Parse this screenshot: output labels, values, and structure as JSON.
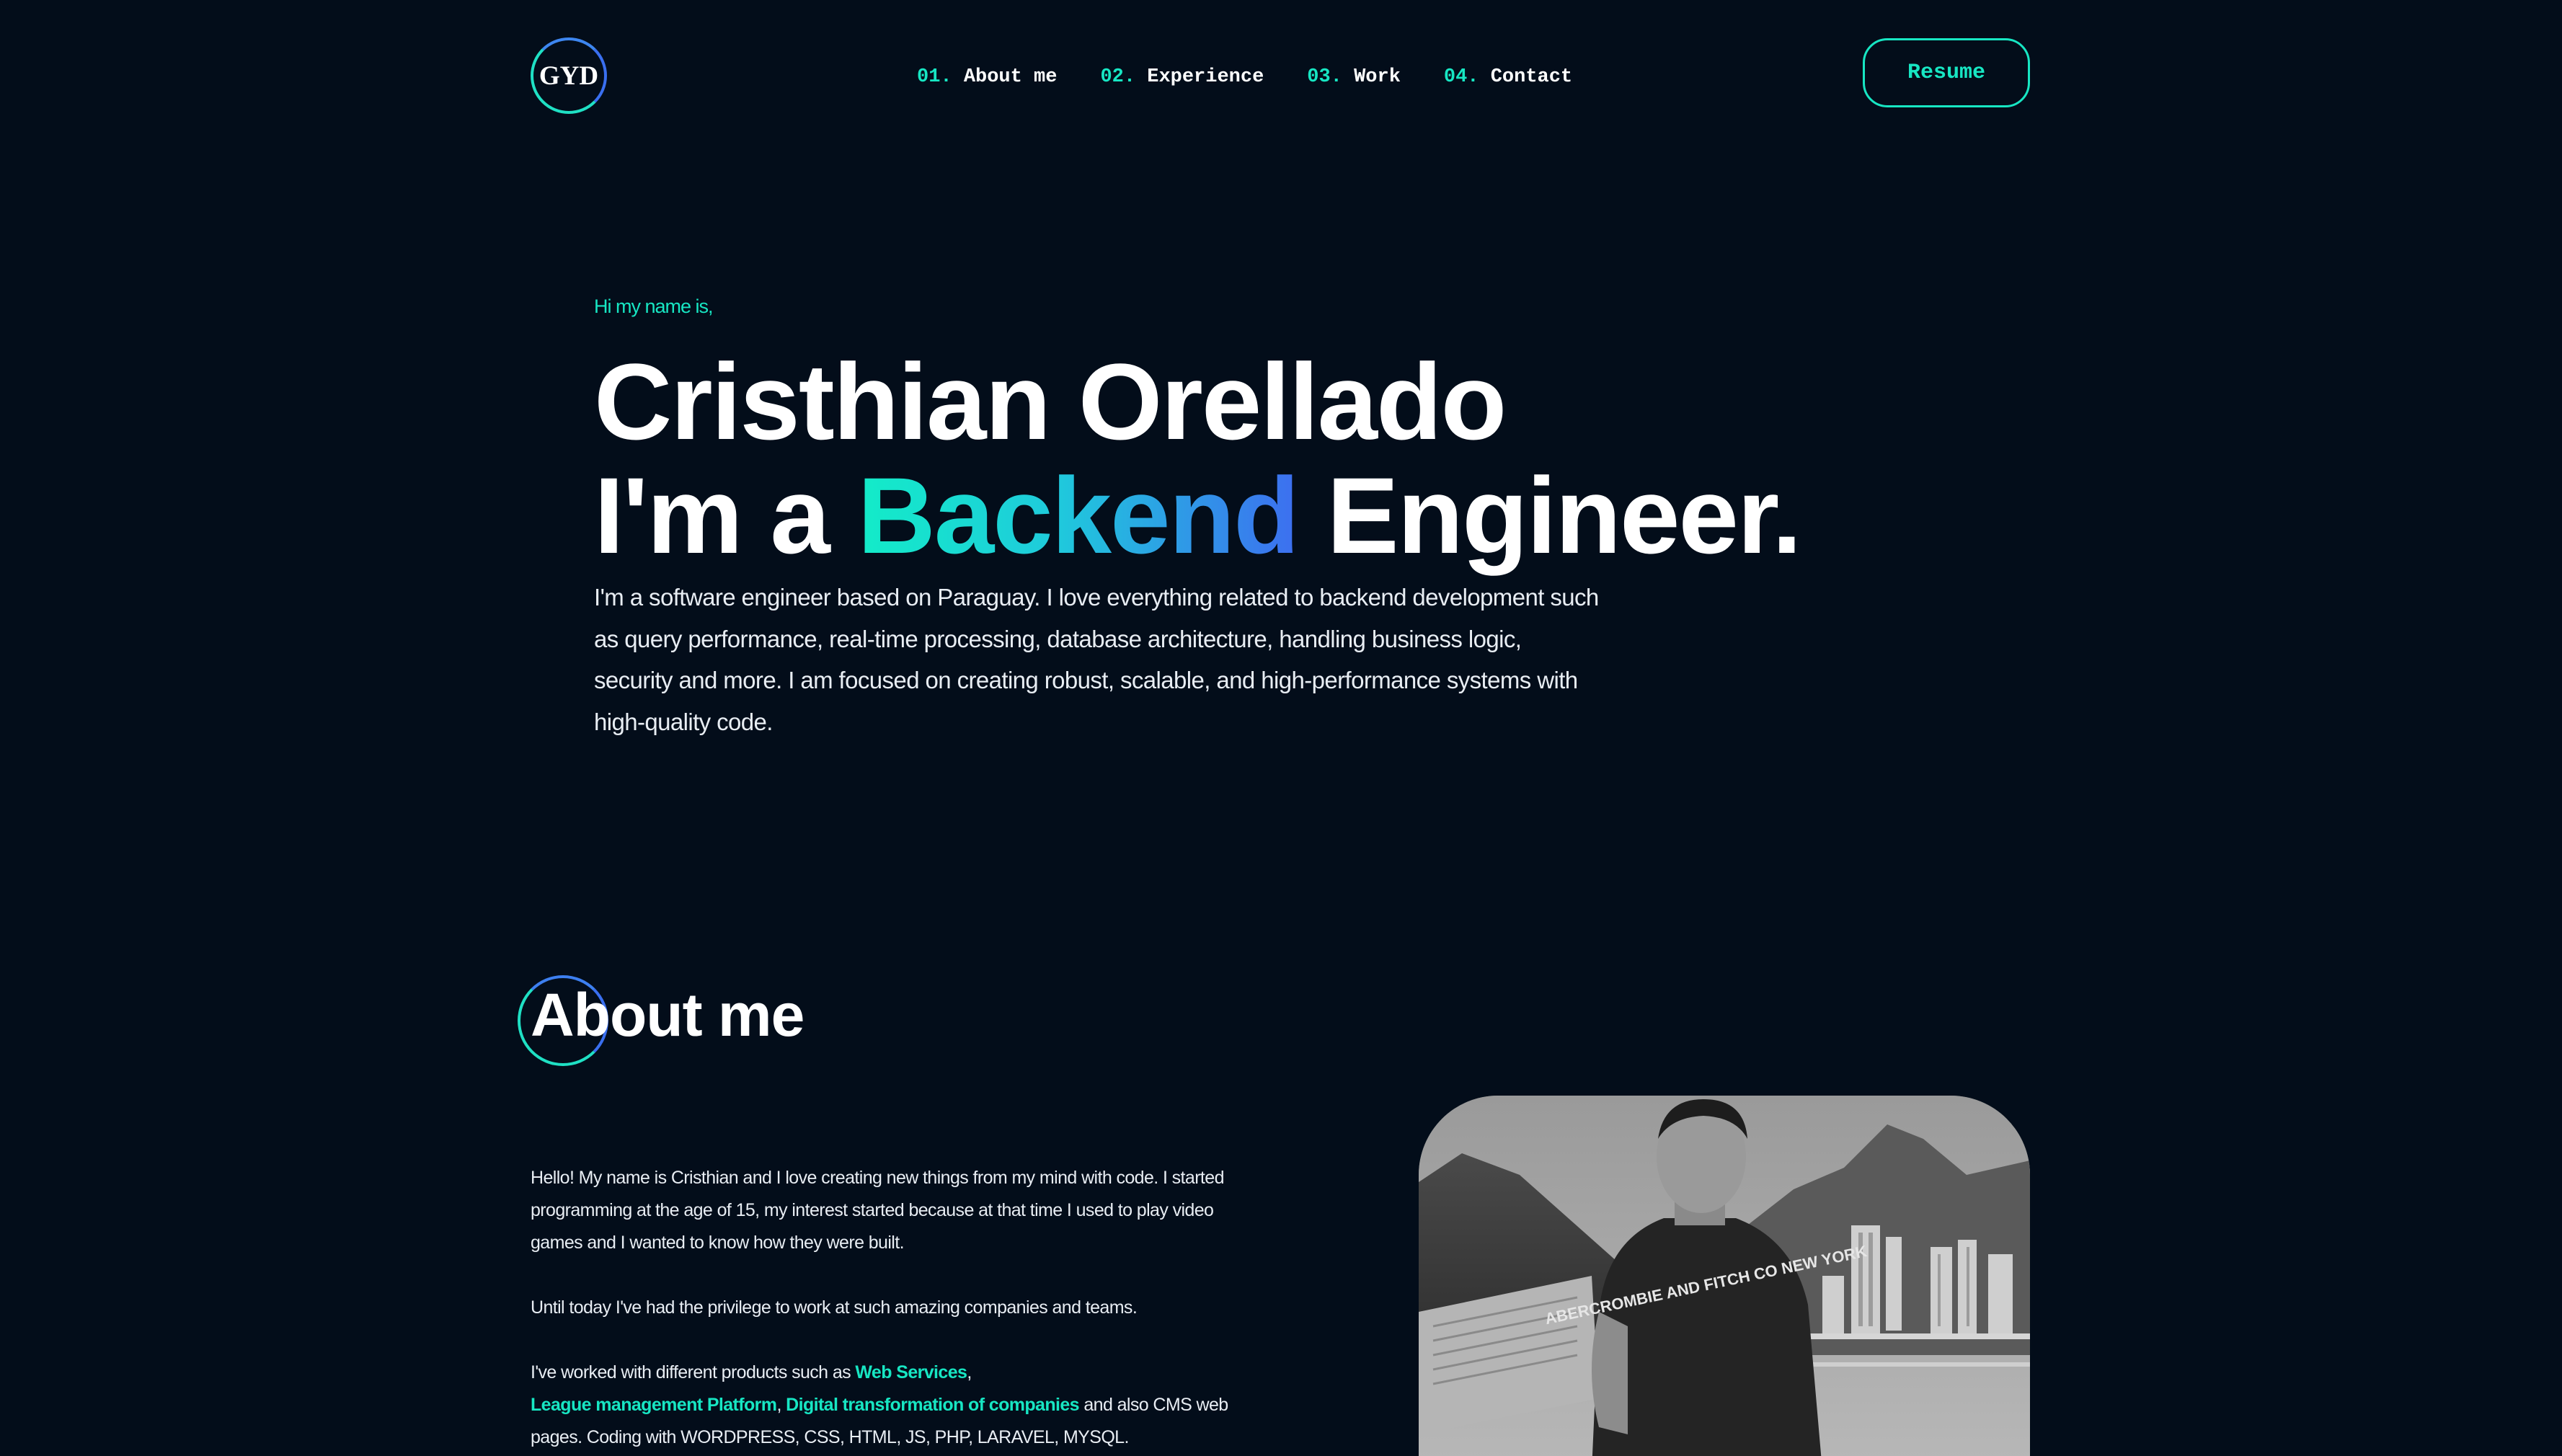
{
  "header": {
    "logo_text": "GYD",
    "nav": [
      {
        "num": "01.",
        "label": "About me"
      },
      {
        "num": "02.",
        "label": "Experience"
      },
      {
        "num": "03.",
        "label": "Work"
      },
      {
        "num": "04.",
        "label": "Contact"
      }
    ],
    "resume_label": "Resume"
  },
  "hero": {
    "greeting": "Hi my name is,",
    "name": "Cristhian Orellado",
    "role_prefix": "I'm a ",
    "role_highlight": "Backend",
    "role_suffix": " Engineer.",
    "description": "I'm a software engineer based on Paraguay. I love everything related to backend development such as query performance, real-time processing, database architecture, handling business logic, security and more. I am focused on creating robust, scalable, and high-performance systems with high-quality code."
  },
  "about": {
    "title": "About me",
    "paragraph1": "Hello! My name is Cristhian and I love creating new things from my mind with code. I started programming at the age of 15, my interest started because at that time I used to play video games and I wanted to know how they were built.",
    "paragraph2": "Until today I've had the privilege to work at such amazing companies and teams.",
    "paragraph3_intro": "I've worked with different products such as ",
    "highlight1": "Web Services",
    "comma1": ",",
    "highlight2": "League management Platform",
    "comma2": ", ",
    "highlight3": "Digital transformation of companies",
    "paragraph3_rest": " and also CMS web pages. Coding with WORDPRESS, CSS, HTML, JS, PHP, LARAVEL, MYSQL.",
    "photo_shirt_text": "ABERCROMBIE AND FITCH CO NEW YORK"
  },
  "colors": {
    "background": "#030d1a",
    "accent": "#17e6c3",
    "accent_blue": "#3d6ef0",
    "text": "#ffffff"
  }
}
